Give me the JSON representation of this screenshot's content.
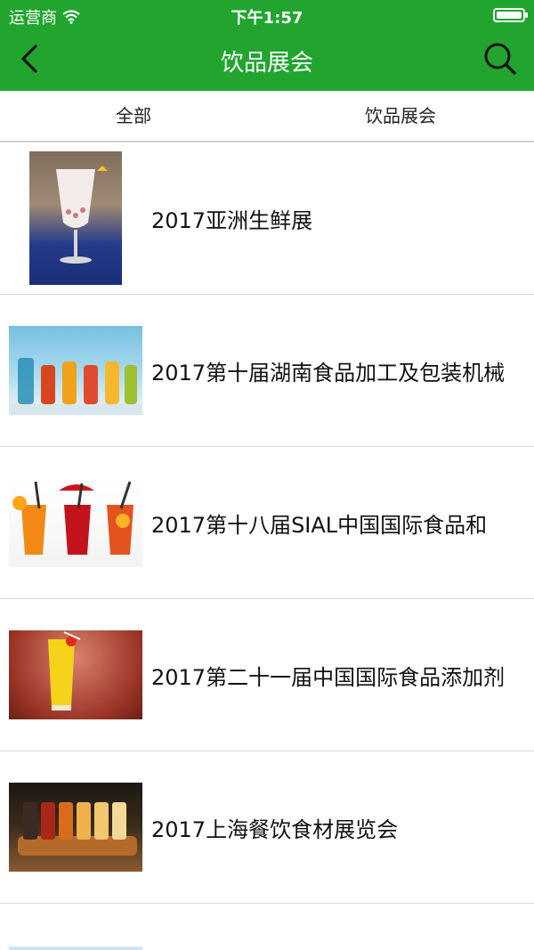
{
  "status": {
    "carrier": "运营商",
    "time": "下午1:57"
  },
  "nav": {
    "title": "饮品展会"
  },
  "tabs": [
    {
      "label": "全部"
    },
    {
      "label": "饮品展会"
    }
  ],
  "items": [
    {
      "title": "2017亚洲生鲜展",
      "thumb_icon": "milk-tea-glass-image"
    },
    {
      "title": "2017第十届湖南食品加工及包装机械",
      "thumb_icon": "colorful-cocktails-image"
    },
    {
      "title": "2017第十八届SIAL中国国际食品和",
      "thumb_icon": "iced-drinks-image"
    },
    {
      "title": "2017第二十一届中国国际食品添加剂",
      "thumb_icon": "juice-glass-image"
    },
    {
      "title": "2017上海餐饮食材展览会",
      "thumb_icon": "beer-flight-image"
    }
  ],
  "colors": {
    "header_green": "#21a52f",
    "divider": "#d8d8d8"
  }
}
